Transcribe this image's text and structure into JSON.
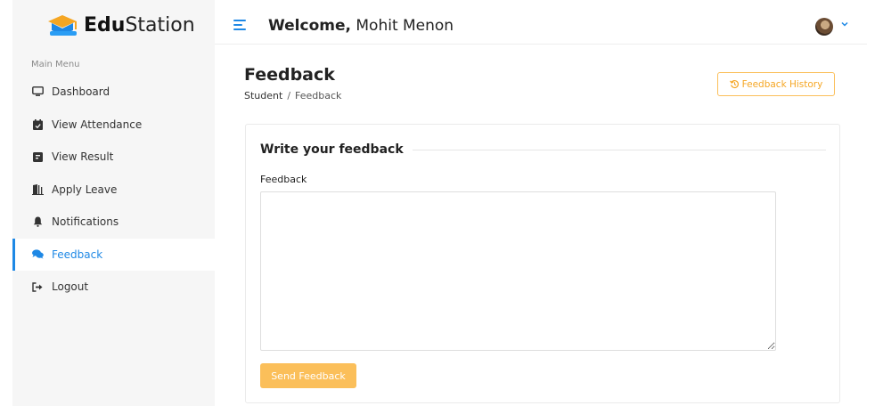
{
  "brand": {
    "name_bold": "Edu",
    "name_regular": "Station"
  },
  "header": {
    "welcome_bold": "Welcome,",
    "user_name": "Mohit Menon"
  },
  "sidebar": {
    "caption": "Main Menu",
    "items": [
      {
        "label": "Dashboard",
        "icon": "monitor-icon",
        "active": false
      },
      {
        "label": "View Attendance",
        "icon": "calendar-check-icon",
        "active": false
      },
      {
        "label": "View Result",
        "icon": "result-icon",
        "active": false
      },
      {
        "label": "Apply Leave",
        "icon": "door-exit-icon",
        "active": false
      },
      {
        "label": "Notifications",
        "icon": "bell-icon",
        "active": false
      },
      {
        "label": "Feedback",
        "icon": "comments-icon",
        "active": true
      },
      {
        "label": "Logout",
        "icon": "sign-out-icon",
        "active": false
      }
    ]
  },
  "page": {
    "title": "Feedback",
    "breadcrumb_root": "Student",
    "breadcrumb_sep": "/",
    "breadcrumb_current": "Feedback",
    "history_button": "Feedback History"
  },
  "form": {
    "section_title": "Write your feedback",
    "field_label": "Feedback",
    "field_value": "",
    "submit_label": "Send Feedback"
  },
  "colors": {
    "accent": "#1e88e5",
    "warning": "#fbbf5a",
    "sidebar_bg": "#f6f6f6"
  }
}
